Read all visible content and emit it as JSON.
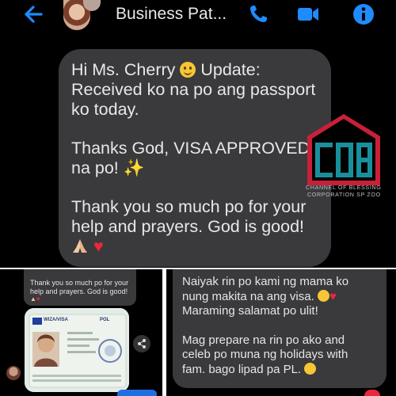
{
  "header": {
    "title": "Business Pat..."
  },
  "main_message": {
    "line1": "Hi Ms. Cherry",
    "line1b": " Update:",
    "line2": "Received ko na po ang passport",
    "line3": "ko today.",
    "line4": "Thanks God, VISA APPROVED",
    "line5": "na po!",
    "line6": "Thank you so much po for your",
    "line7": "help and prayers. God is good!"
  },
  "logo": {
    "caption_line1": "CHANNEL OF BLESSING",
    "caption_line2": "CORPORATION SP ZOO"
  },
  "bottom_left": {
    "message_line1": "Thank you so much po for your",
    "message_line2": "help and prayers. God is good!",
    "visa_label": "WIZA/VISA",
    "visa_country": "POL"
  },
  "bottom_right": {
    "line1": "Naiyak rin po kami ng mama ko",
    "line2": "nung makita na ang visa.",
    "line3": "Maraming salamat po ulit!",
    "line4": "Mag prepare na rin po ako and",
    "line5": "celeb po muna ng holidays with",
    "line6": "fam. bago lipad pa PL."
  },
  "colors": {
    "accent_blue": "#1f8bff",
    "bubble_gray": "#3a3a3c",
    "logo_teal": "#1a8f9c",
    "logo_red": "#c9203a"
  },
  "icons": [
    "back-arrow-icon",
    "phone-icon",
    "video-camera-icon",
    "info-icon",
    "smile-emoji-icon",
    "sparkles-emoji-icon",
    "praying-hands-emoji-icon",
    "red-heart-emoji-icon",
    "teary-emoji-icon",
    "share-icon"
  ]
}
